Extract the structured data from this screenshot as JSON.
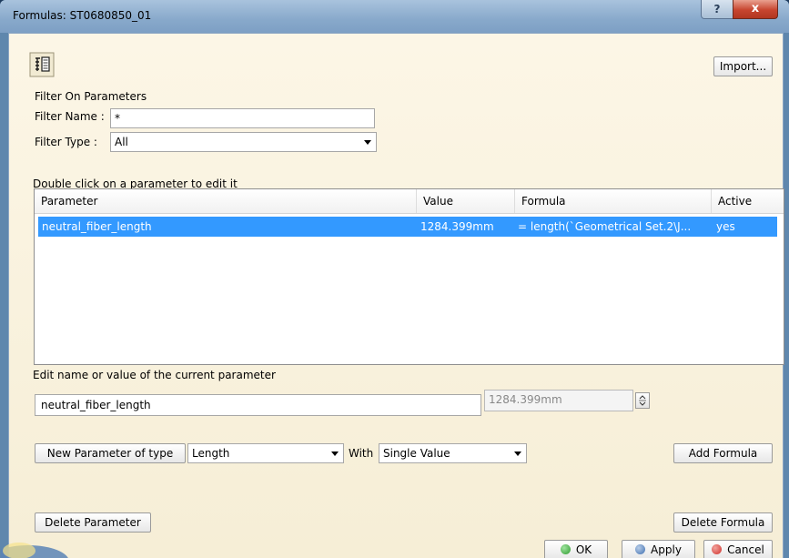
{
  "window": {
    "title": "Formulas: ST0680850_01",
    "help_label": "?",
    "close_label": "x"
  },
  "toolbar": {
    "import_label": "Import..."
  },
  "filter": {
    "section_label": "Filter On Parameters",
    "name_label": "Filter Name :",
    "name_value": "*",
    "type_label": "Filter Type :",
    "type_value": "All"
  },
  "list": {
    "hint": "Double click on a parameter to edit it",
    "columns": [
      "Parameter",
      "Value",
      "Formula",
      "Active"
    ],
    "rows": [
      {
        "parameter": "neutral_fiber_length",
        "value": "1284.399mm",
        "formula": "= length(`Geometrical Set.2\\J...",
        "active": "yes",
        "selected": true
      }
    ]
  },
  "edit": {
    "label": "Edit name or value of the current parameter",
    "name_value": "neutral_fiber_length",
    "value_value": "1284.399mm"
  },
  "new_param": {
    "button_label": "New Parameter of type",
    "type_value": "Length",
    "with_label": "With",
    "with_value": "Single Value",
    "add_formula_label": "Add Formula"
  },
  "actions": {
    "delete_parameter_label": "Delete Parameter",
    "delete_formula_label": "Delete Formula",
    "ok_label": "OK",
    "apply_label": "Apply",
    "cancel_label": "Cancel"
  },
  "colors": {
    "selection": "#3399ff",
    "ok_dot": "#2e9b2e",
    "apply_dot": "#3f6fb0",
    "cancel_dot": "#d0302a"
  }
}
